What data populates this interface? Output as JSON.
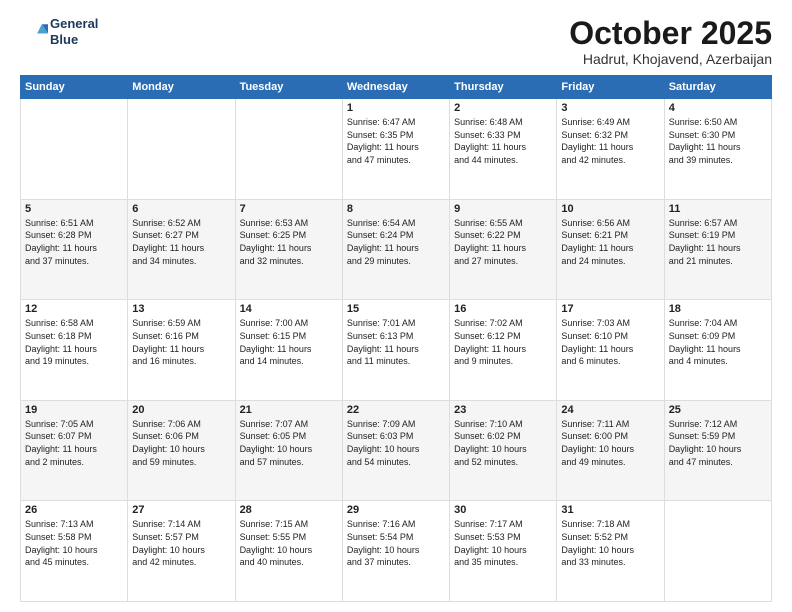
{
  "header": {
    "logo_line1": "General",
    "logo_line2": "Blue",
    "month": "October 2025",
    "location": "Hadrut, Khojavend, Azerbaijan"
  },
  "weekdays": [
    "Sunday",
    "Monday",
    "Tuesday",
    "Wednesday",
    "Thursday",
    "Friday",
    "Saturday"
  ],
  "weeks": [
    [
      {
        "day": "",
        "text": ""
      },
      {
        "day": "",
        "text": ""
      },
      {
        "day": "",
        "text": ""
      },
      {
        "day": "1",
        "text": "Sunrise: 6:47 AM\nSunset: 6:35 PM\nDaylight: 11 hours\nand 47 minutes."
      },
      {
        "day": "2",
        "text": "Sunrise: 6:48 AM\nSunset: 6:33 PM\nDaylight: 11 hours\nand 44 minutes."
      },
      {
        "day": "3",
        "text": "Sunrise: 6:49 AM\nSunset: 6:32 PM\nDaylight: 11 hours\nand 42 minutes."
      },
      {
        "day": "4",
        "text": "Sunrise: 6:50 AM\nSunset: 6:30 PM\nDaylight: 11 hours\nand 39 minutes."
      }
    ],
    [
      {
        "day": "5",
        "text": "Sunrise: 6:51 AM\nSunset: 6:28 PM\nDaylight: 11 hours\nand 37 minutes."
      },
      {
        "day": "6",
        "text": "Sunrise: 6:52 AM\nSunset: 6:27 PM\nDaylight: 11 hours\nand 34 minutes."
      },
      {
        "day": "7",
        "text": "Sunrise: 6:53 AM\nSunset: 6:25 PM\nDaylight: 11 hours\nand 32 minutes."
      },
      {
        "day": "8",
        "text": "Sunrise: 6:54 AM\nSunset: 6:24 PM\nDaylight: 11 hours\nand 29 minutes."
      },
      {
        "day": "9",
        "text": "Sunrise: 6:55 AM\nSunset: 6:22 PM\nDaylight: 11 hours\nand 27 minutes."
      },
      {
        "day": "10",
        "text": "Sunrise: 6:56 AM\nSunset: 6:21 PM\nDaylight: 11 hours\nand 24 minutes."
      },
      {
        "day": "11",
        "text": "Sunrise: 6:57 AM\nSunset: 6:19 PM\nDaylight: 11 hours\nand 21 minutes."
      }
    ],
    [
      {
        "day": "12",
        "text": "Sunrise: 6:58 AM\nSunset: 6:18 PM\nDaylight: 11 hours\nand 19 minutes."
      },
      {
        "day": "13",
        "text": "Sunrise: 6:59 AM\nSunset: 6:16 PM\nDaylight: 11 hours\nand 16 minutes."
      },
      {
        "day": "14",
        "text": "Sunrise: 7:00 AM\nSunset: 6:15 PM\nDaylight: 11 hours\nand 14 minutes."
      },
      {
        "day": "15",
        "text": "Sunrise: 7:01 AM\nSunset: 6:13 PM\nDaylight: 11 hours\nand 11 minutes."
      },
      {
        "day": "16",
        "text": "Sunrise: 7:02 AM\nSunset: 6:12 PM\nDaylight: 11 hours\nand 9 minutes."
      },
      {
        "day": "17",
        "text": "Sunrise: 7:03 AM\nSunset: 6:10 PM\nDaylight: 11 hours\nand 6 minutes."
      },
      {
        "day": "18",
        "text": "Sunrise: 7:04 AM\nSunset: 6:09 PM\nDaylight: 11 hours\nand 4 minutes."
      }
    ],
    [
      {
        "day": "19",
        "text": "Sunrise: 7:05 AM\nSunset: 6:07 PM\nDaylight: 11 hours\nand 2 minutes."
      },
      {
        "day": "20",
        "text": "Sunrise: 7:06 AM\nSunset: 6:06 PM\nDaylight: 10 hours\nand 59 minutes."
      },
      {
        "day": "21",
        "text": "Sunrise: 7:07 AM\nSunset: 6:05 PM\nDaylight: 10 hours\nand 57 minutes."
      },
      {
        "day": "22",
        "text": "Sunrise: 7:09 AM\nSunset: 6:03 PM\nDaylight: 10 hours\nand 54 minutes."
      },
      {
        "day": "23",
        "text": "Sunrise: 7:10 AM\nSunset: 6:02 PM\nDaylight: 10 hours\nand 52 minutes."
      },
      {
        "day": "24",
        "text": "Sunrise: 7:11 AM\nSunset: 6:00 PM\nDaylight: 10 hours\nand 49 minutes."
      },
      {
        "day": "25",
        "text": "Sunrise: 7:12 AM\nSunset: 5:59 PM\nDaylight: 10 hours\nand 47 minutes."
      }
    ],
    [
      {
        "day": "26",
        "text": "Sunrise: 7:13 AM\nSunset: 5:58 PM\nDaylight: 10 hours\nand 45 minutes."
      },
      {
        "day": "27",
        "text": "Sunrise: 7:14 AM\nSunset: 5:57 PM\nDaylight: 10 hours\nand 42 minutes."
      },
      {
        "day": "28",
        "text": "Sunrise: 7:15 AM\nSunset: 5:55 PM\nDaylight: 10 hours\nand 40 minutes."
      },
      {
        "day": "29",
        "text": "Sunrise: 7:16 AM\nSunset: 5:54 PM\nDaylight: 10 hours\nand 37 minutes."
      },
      {
        "day": "30",
        "text": "Sunrise: 7:17 AM\nSunset: 5:53 PM\nDaylight: 10 hours\nand 35 minutes."
      },
      {
        "day": "31",
        "text": "Sunrise: 7:18 AM\nSunset: 5:52 PM\nDaylight: 10 hours\nand 33 minutes."
      },
      {
        "day": "",
        "text": ""
      }
    ]
  ]
}
